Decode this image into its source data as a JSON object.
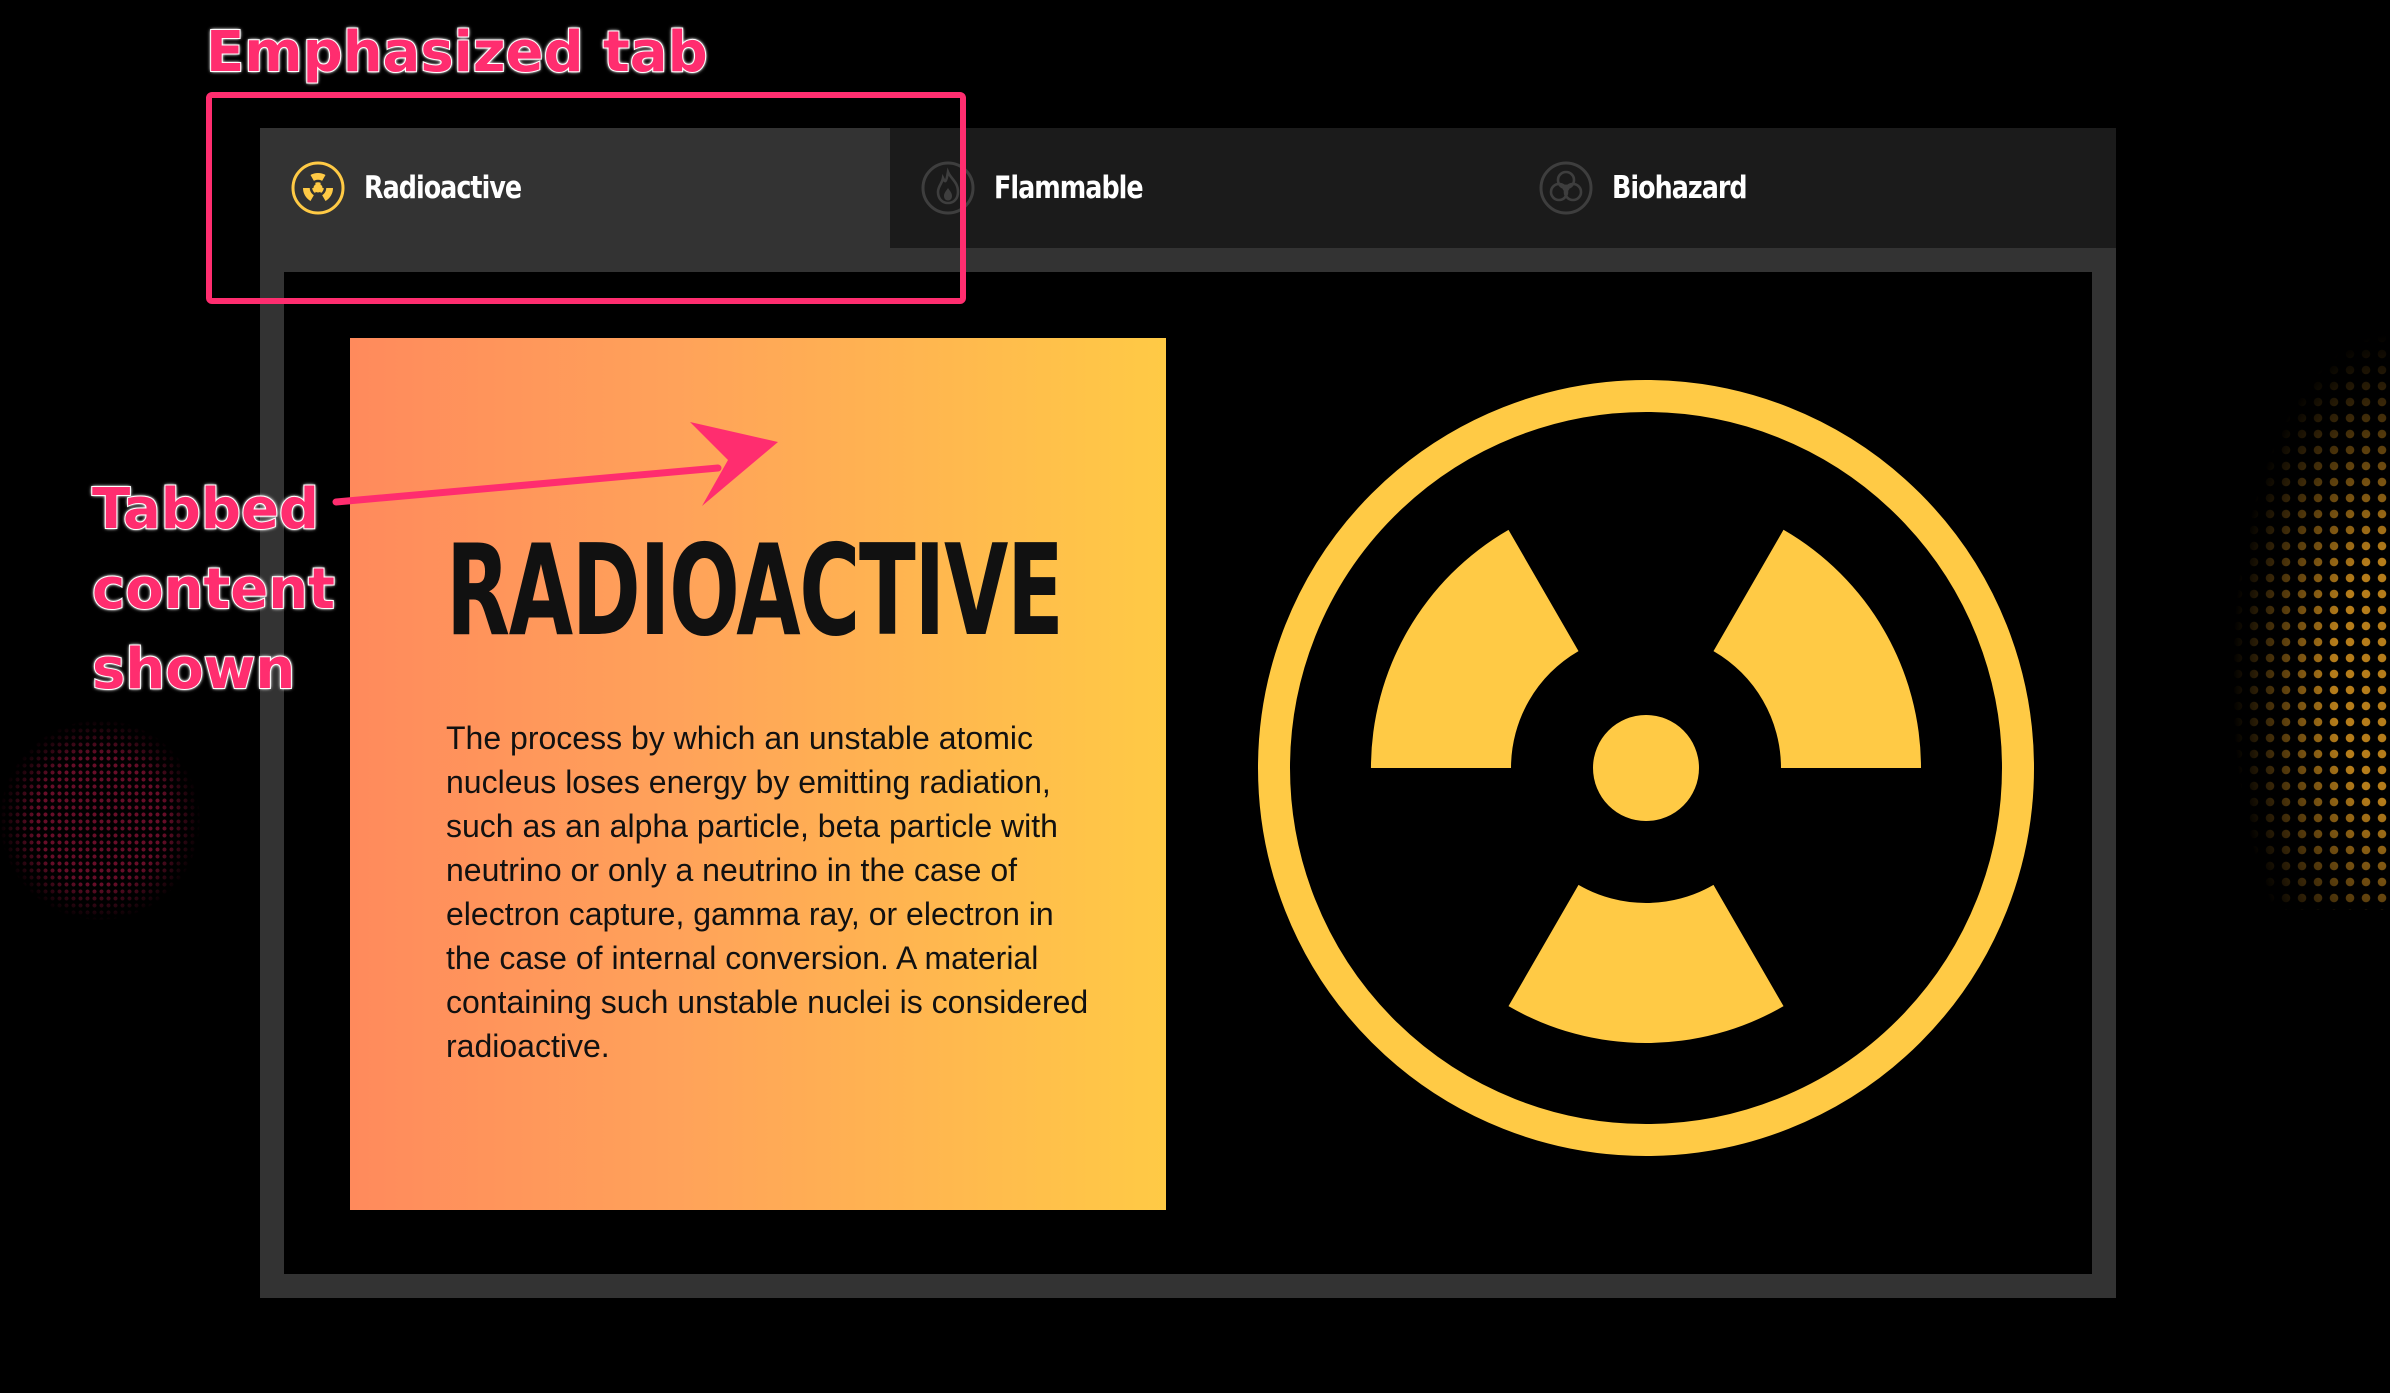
{
  "tabs": [
    {
      "label": "Radioactive",
      "icon": "radioactive-icon",
      "active": true
    },
    {
      "label": "Flammable",
      "icon": "flame-icon",
      "active": false
    },
    {
      "label": "Biohazard",
      "icon": "biohazard-icon",
      "active": false
    }
  ],
  "content": {
    "title": "RADIOACTIVE",
    "body": "The process by which an unstable atomic nucleus loses energy by emitting radiation, such as an alpha particle, beta particle with neutrino or only a neutrino in the case of electron capture, gamma ray, or electron in the case of internal conversion. A material containing such unstable nuclei is considered radioactive.",
    "symbol": "radioactive-symbol"
  },
  "annotations": {
    "tab_label": "Emphasized tab",
    "content_label": "Tabbed content shown"
  },
  "colors": {
    "background": "#000000",
    "tab_bar": "#1b1b1b",
    "active_tab": "#333333",
    "panel_border": "#333333",
    "accent_yellow": "#ffca45",
    "gradient_start": "#ff8a5c",
    "annotation_pink": "#ff2d6f"
  }
}
